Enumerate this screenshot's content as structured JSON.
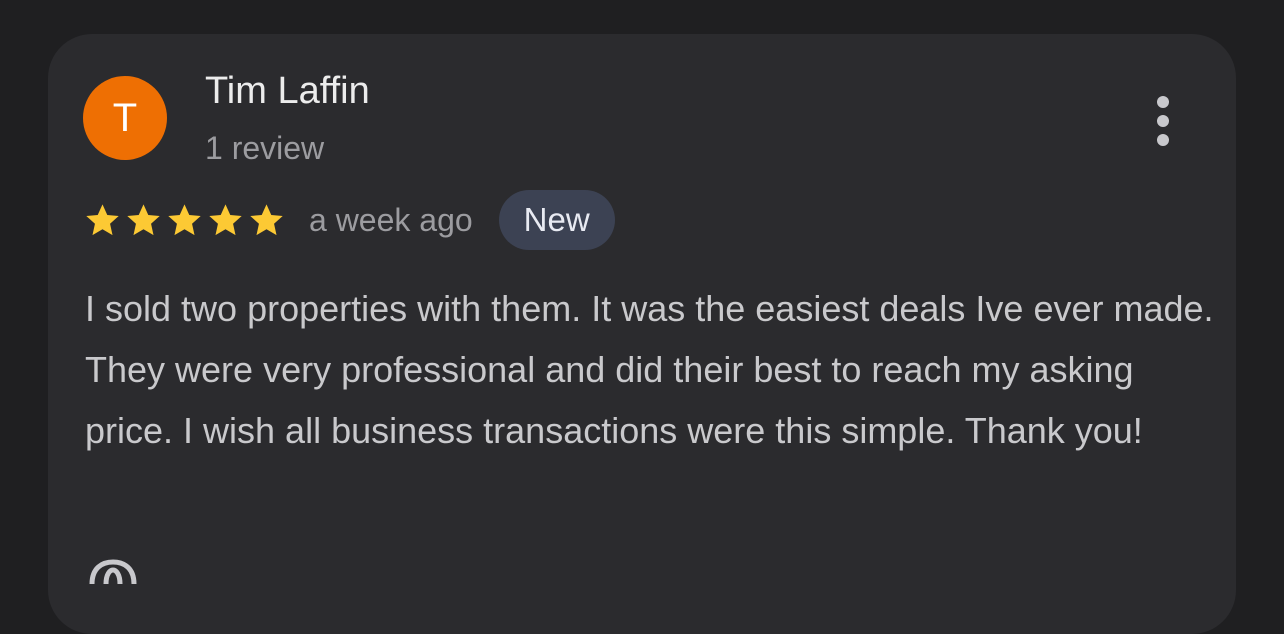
{
  "review": {
    "avatar_initial": "T",
    "reviewer_name": "Tim Laffin",
    "review_count": "1 review",
    "rating": 5,
    "rating_max": 5,
    "time_ago": "a week ago",
    "badge": "New",
    "text": "I sold two properties with them. It was the easiest deals Ive ever made. They were very professional and did their best to reach my asking price. I wish all business transactions were this simple. Thank you!"
  },
  "icons": {
    "more": "more-vert-icon",
    "star": "star-icon",
    "bottom": "thumbs-up-icon"
  },
  "colors": {
    "background": "#1f1f21",
    "card": "#2b2b2e",
    "avatar": "#ee6f03",
    "star": "#fcc934",
    "badge_bg": "#3c4253",
    "primary_text": "#ececec",
    "secondary_text": "#9c9ca0",
    "body_text": "#c9c9cc"
  }
}
